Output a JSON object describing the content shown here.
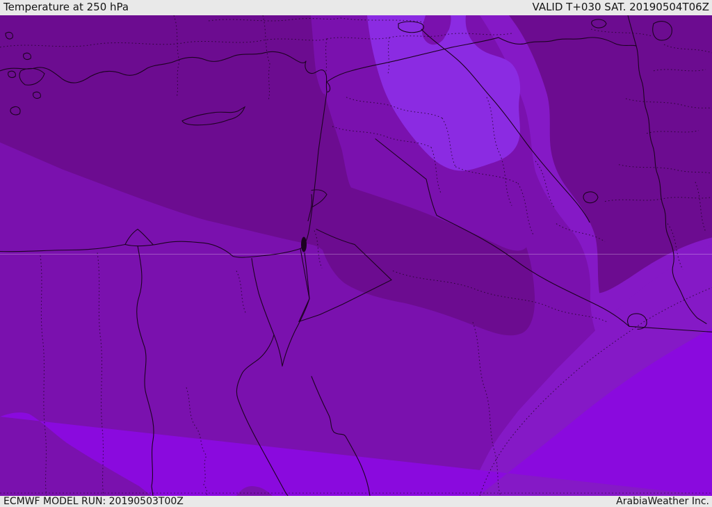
{
  "header": {
    "title": "Temperature at 250 hPa",
    "valid": "VALID T+030 SAT. 20190504T06Z"
  },
  "footer": {
    "model_run": "ECMWF MODEL RUN: 20190503T00Z",
    "credit": "ArabiaWeather Inc."
  },
  "map": {
    "region": "Middle East / Eastern Mediterranean",
    "layer": "temperature shading at 250 hPa",
    "bands": [
      {
        "name": "band-dark",
        "color": "#6c0c90"
      },
      {
        "name": "band-medium",
        "color": "#7a11ae"
      },
      {
        "name": "band-mid-bright",
        "color": "#8519c6"
      },
      {
        "name": "band-blueviolet",
        "color": "#8b2be2"
      },
      {
        "name": "band-bright-violet",
        "color": "#8a0ade"
      }
    ]
  },
  "colors": {
    "band_dark": "#6c0c90",
    "band_medium": "#7a11ae",
    "band_mid_bright": "#8519c6",
    "band_blueviolet": "#8b2be2",
    "band_bright": "#8a0ade",
    "border_line": "#1c0220",
    "bar_bg": "#e9e9e9",
    "bar_text": "#141414"
  }
}
